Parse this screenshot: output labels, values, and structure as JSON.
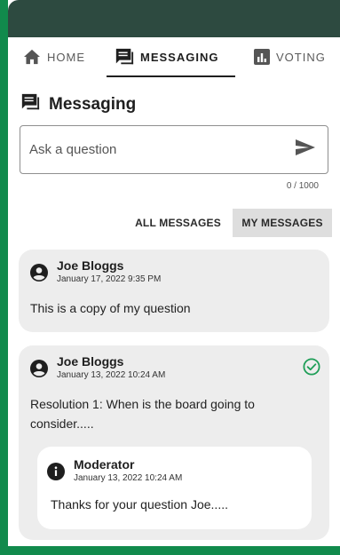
{
  "tabs": {
    "home": "HOME",
    "messaging": "MESSAGING",
    "voting": "VOTING"
  },
  "section": {
    "title": "Messaging"
  },
  "ask": {
    "placeholder": "Ask a question",
    "counter": "0 / 1000"
  },
  "filters": {
    "all": "ALL MESSAGES",
    "mine": "MY MESSAGES",
    "selected": "mine"
  },
  "messages": [
    {
      "author": "Joe Bloggs",
      "date": "January 17, 2022 9:35 PM",
      "text": "This is a copy of my question",
      "answered": false
    },
    {
      "author": "Joe Bloggs",
      "date": "January 13, 2022 10:24 AM",
      "text": "Resolution 1: When is the board going to consider.....",
      "answered": true,
      "reply": {
        "author": "Moderator",
        "date": "January 13, 2022 10:24 AM",
        "text": "Thanks for your question Joe....."
      }
    }
  ],
  "colors": {
    "frame_green": "#118a4c",
    "topbar": "#2d4a40",
    "check_green": "#1e9e57",
    "card_bg": "#ededed"
  },
  "icons": {
    "home": "home-icon",
    "messaging": "chat-icon",
    "voting": "bar-chart-icon",
    "send": "send-icon",
    "avatar": "account-circle-icon",
    "info": "info-icon",
    "answered": "check-circle-icon"
  }
}
